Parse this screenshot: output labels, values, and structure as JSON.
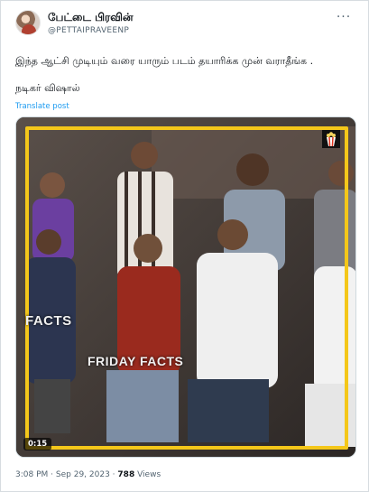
{
  "tweet": {
    "author": {
      "display_name": "பேட்டை பிரவின்",
      "handle": "@PETTAIPRAVEENP"
    },
    "more_menu_label": "···",
    "text_line_1": "இந்த ஆட்சி முடியும் வரை யாரும் படம் தயாரிக்க முன் வராதீங்க .",
    "text_line_2": "நடிகர் விஷால்",
    "translate_label": "Translate post",
    "media": {
      "overlay_text_1": "FACTS",
      "overlay_text_2": "FRIDAY FACTS",
      "duration": "0:15",
      "accent_color": "#f4c71a"
    },
    "time": "3:08 PM",
    "date": "Sep 29, 2023",
    "views_count": "788",
    "views_label": "Views",
    "separator": "·"
  },
  "colors": {
    "link": "#1d9bf0",
    "secondary_text": "#536471",
    "primary_text": "#0f1419"
  }
}
